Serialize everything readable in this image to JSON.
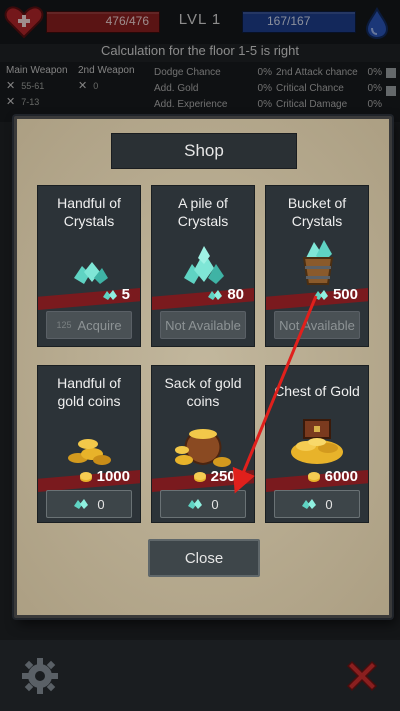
{
  "hud": {
    "hp_text": "476/476",
    "level_text": "LVL 1",
    "mana_text": "167/167"
  },
  "calc_note": "Calculation for the floor 1-5 is right",
  "stats": {
    "main_weapon_label": "Main Weapon",
    "main_weapon_dmg1": "55-61",
    "main_weapon_dmg2": "7-13",
    "second_weapon_label": "2nd Weapon",
    "second_weapon_val": "0",
    "lines": [
      {
        "label": "Dodge Chance",
        "value": "0%"
      },
      {
        "label": "2nd Attack chance",
        "value": "0%"
      },
      {
        "label": "Add. Gold",
        "value": "0%"
      },
      {
        "label": "Critical Chance",
        "value": "0%"
      },
      {
        "label": "Add. Experience",
        "value": "0%"
      },
      {
        "label": "Critical Damage",
        "value": "0%"
      }
    ]
  },
  "shop": {
    "title": "Shop",
    "items": [
      {
        "name_line1": "Handful of",
        "name_line2": "Crystals",
        "price": "5",
        "price_currency": "gold",
        "button": "Acquire",
        "button_prefix": "125",
        "button_state": "disabled"
      },
      {
        "name_line1": "A pile of",
        "name_line2": "Crystals",
        "price": "80",
        "price_currency": "gold",
        "button": "Not Available",
        "button_state": "disabled"
      },
      {
        "name_line1": "Bucket of",
        "name_line2": "Crystals",
        "price": "500",
        "price_currency": "gold",
        "button": "Not Available",
        "button_state": "disabled"
      },
      {
        "name_line1": "Handful of",
        "name_line2": "gold coins",
        "price": "1000",
        "price_currency": "gold",
        "button": "0",
        "button_currency": "crystal",
        "button_state": "active"
      },
      {
        "name_line1": "Sack of gold",
        "name_line2": "coins",
        "price": "2500",
        "price_currency": "gold",
        "button": "0",
        "button_currency": "crystal",
        "button_state": "active"
      },
      {
        "name_line1": "Chest of Gold",
        "name_line2": "",
        "price": "6000",
        "price_currency": "gold",
        "button": "0",
        "button_currency": "crystal",
        "button_state": "active"
      }
    ],
    "close_label": "Close"
  },
  "colors": {
    "hp": "#8a1f1f",
    "mana": "#1e3e8c",
    "ribbon": "#7a1a1e",
    "annotation_arrow": "#e0201c",
    "crystal": "#5fd3c3",
    "gold": "#e8b32a"
  },
  "icons": [
    "heart-icon",
    "mana-drop-icon",
    "sword-icon",
    "crystal-icon",
    "gold-coin-icon",
    "gear-icon",
    "close-x-icon"
  ]
}
